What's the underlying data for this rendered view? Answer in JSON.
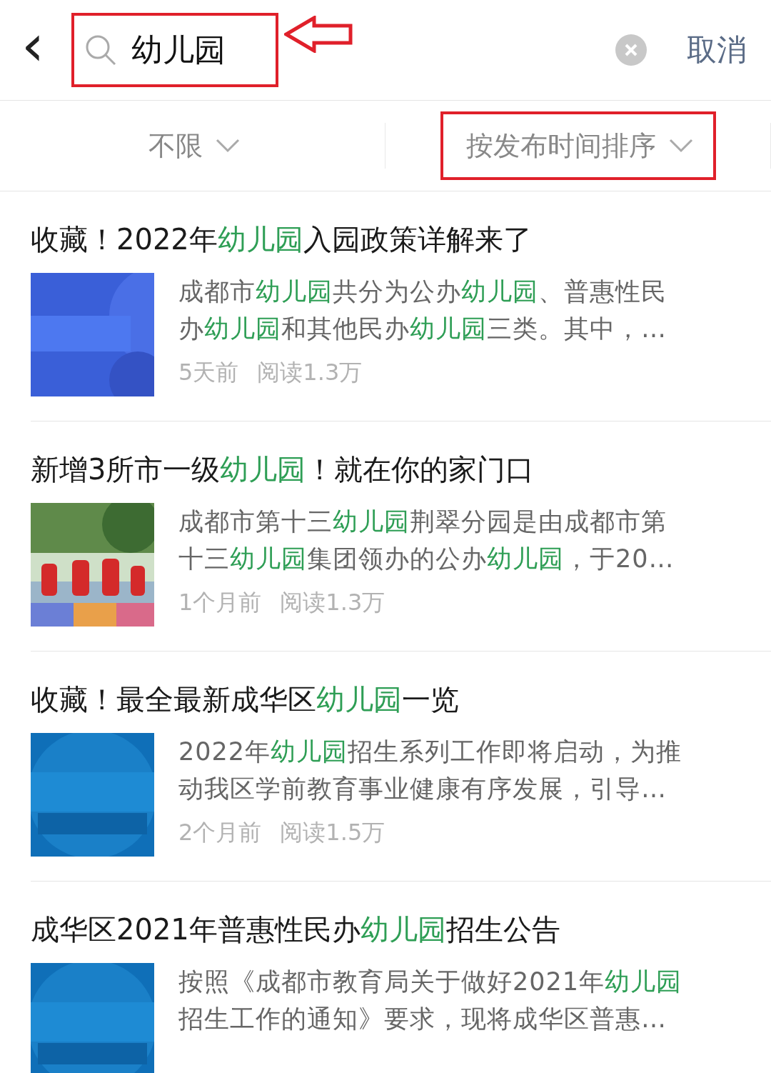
{
  "search": {
    "back": "‹",
    "query": "幼儿园",
    "highlighted": true,
    "pointer_arrow": true,
    "cancel": "取消"
  },
  "filters": [
    {
      "label": "不限",
      "highlighted": false
    },
    {
      "label": "按发布时间排序",
      "highlighted": true
    }
  ],
  "articles": [
    {
      "title": [
        {
          "text": "收藏！2022年",
          "hl": false
        },
        {
          "text": "幼儿园",
          "hl": true
        },
        {
          "text": "入园政策详解来了",
          "hl": false
        }
      ],
      "thumb": {
        "kind": "picture"
      },
      "snippet": [
        [
          {
            "text": "成都市",
            "hl": false
          },
          {
            "text": "幼儿园",
            "hl": true
          },
          {
            "text": "共分为公办",
            "hl": false
          },
          {
            "text": "幼儿园",
            "hl": true
          },
          {
            "text": "、普惠性民",
            "hl": false
          }
        ],
        [
          {
            "text": "办",
            "hl": false
          },
          {
            "text": "幼儿园",
            "hl": true
          },
          {
            "text": "和其他民办",
            "hl": false
          },
          {
            "text": "幼儿园",
            "hl": true
          },
          {
            "text": "三类。其中，…",
            "hl": false
          }
        ]
      ],
      "time": "5天前",
      "reads": "阅读1.3万"
    },
    {
      "title": [
        {
          "text": "新增3所市一级",
          "hl": false
        },
        {
          "text": "幼儿园",
          "hl": true
        },
        {
          "text": "！就在你的家门口",
          "hl": false
        }
      ],
      "thumb": {
        "kind": "picture"
      },
      "snippet": [
        [
          {
            "text": "成都市第十三",
            "hl": false
          },
          {
            "text": "幼儿园",
            "hl": true
          },
          {
            "text": "荆翠分园是由成都市第",
            "hl": false
          }
        ],
        [
          {
            "text": "十三",
            "hl": false
          },
          {
            "text": "幼儿园",
            "hl": true
          },
          {
            "text": "集团领办的公办",
            "hl": false
          },
          {
            "text": "幼儿园",
            "hl": true
          },
          {
            "text": "，于20…",
            "hl": false
          }
        ]
      ],
      "time": "1个月前",
      "reads": "阅读1.3万"
    },
    {
      "title": [
        {
          "text": "收藏！最全最新成华区",
          "hl": false
        },
        {
          "text": "幼儿园",
          "hl": true
        },
        {
          "text": "一览",
          "hl": false
        }
      ],
      "thumb": {
        "kind": "picture"
      },
      "snippet": [
        [
          {
            "text": "2022年",
            "hl": false
          },
          {
            "text": "幼儿园",
            "hl": true
          },
          {
            "text": "招生系列工作即将启动，为推",
            "hl": false
          }
        ],
        [
          {
            "text": "动我区学前教育事业健康有序发展，引导…",
            "hl": false
          }
        ]
      ],
      "time": "2个月前",
      "reads": "阅读1.5万"
    },
    {
      "title": [
        {
          "text": "成华区2021年普惠性民办",
          "hl": false
        },
        {
          "text": "幼儿园",
          "hl": true
        },
        {
          "text": "招生公告",
          "hl": false
        }
      ],
      "thumb": {
        "kind": "picture"
      },
      "snippet": [
        [
          {
            "text": "按照《成都市教育局关于做好2021年",
            "hl": false
          },
          {
            "text": "幼儿园",
            "hl": true
          }
        ],
        [
          {
            "text": "招生工作的通知》要求，现将成华区普惠…",
            "hl": false
          }
        ]
      ]
    }
  ]
}
